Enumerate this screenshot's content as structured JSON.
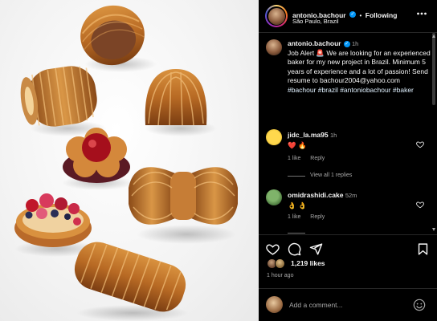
{
  "post": {
    "username": "antonio.bachour",
    "follow_label": "Following",
    "location": "São Paulo, Brazil",
    "more_icon": "more-dots-icon"
  },
  "caption": {
    "username": "antonio.bachour",
    "age": "1h",
    "text_main": "Job Alert 🚨 We are looking for an experienced baker for my new project in Brazil. Minimum 5 years of experience and a lot of passion! Send resume to bachour2004@yahoo.com",
    "hashtags": "#bachour #brazil #antoniobachour #baker"
  },
  "comments": [
    {
      "username": "jidc_la.ma95",
      "age": "1h",
      "text": "❤️ 🔥",
      "likes": "1 like",
      "reply_label": "Reply",
      "view_replies": "View all 1 replies"
    },
    {
      "username": "omidrashidi.cake",
      "age": "52m",
      "text": "👌 👌",
      "likes": "1 like",
      "reply_label": "Reply"
    }
  ],
  "actions": {
    "like_icon": "heart-icon",
    "comment_icon": "comment-icon",
    "share_icon": "send-icon",
    "save_icon": "bookmark-icon"
  },
  "likes_count": "1,219 likes",
  "posted_ago": "1 hour ago",
  "add_comment": {
    "placeholder": "Add a comment..."
  },
  "colors": {
    "background": "#000000",
    "text": "#f5f5f5",
    "muted": "#a8a8a8",
    "verified": "#0095f6",
    "hashtag": "#e0f1ff"
  }
}
